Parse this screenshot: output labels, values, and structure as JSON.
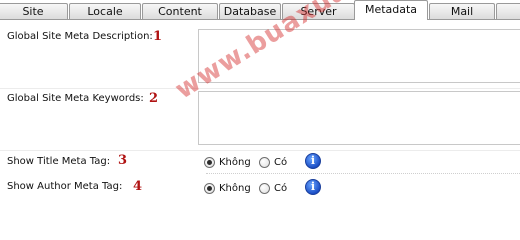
{
  "tabs": [
    {
      "label": "Site",
      "active": false
    },
    {
      "label": "Locale",
      "active": false
    },
    {
      "label": "Content",
      "active": false
    },
    {
      "label": "Database",
      "active": false
    },
    {
      "label": "Server",
      "active": false
    },
    {
      "label": "Metadata",
      "active": true
    },
    {
      "label": "Mail",
      "active": false
    },
    {
      "label": "",
      "active": false
    }
  ],
  "fields": {
    "description": {
      "label": "Global Site Meta Description:",
      "number": "1",
      "value": ""
    },
    "keywords": {
      "label": "Global Site Meta Keywords:",
      "number": "2",
      "value": ""
    },
    "show_title": {
      "label": "Show Title Meta Tag:",
      "number": "3",
      "option_no": "Không",
      "option_yes": "Có",
      "selected": "no"
    },
    "show_author": {
      "label": "Show Author Meta Tag:",
      "number": "4",
      "option_no": "Không",
      "option_yes": "Có",
      "selected": "no"
    }
  },
  "info_icon_glyph": "i",
  "watermark": "www.buaxua.vn",
  "colors": {
    "number": "#b01212",
    "info_icon": "#1c4fc6",
    "watermark": "#d22828"
  }
}
